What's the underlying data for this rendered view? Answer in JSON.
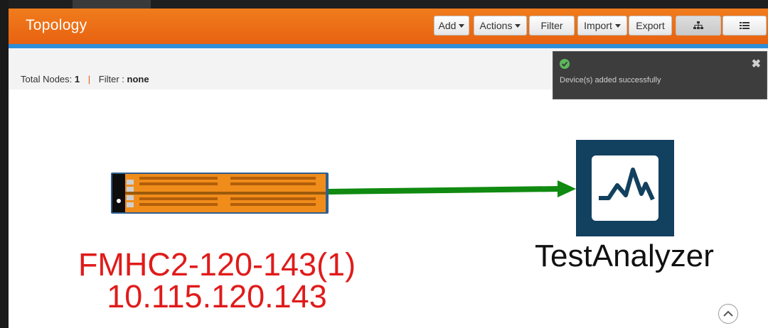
{
  "header": {
    "title": "Topology",
    "buttons": {
      "add": "Add",
      "actions": "Actions",
      "filter": "Filter",
      "import": "Import",
      "export": "Export"
    }
  },
  "info": {
    "total_nodes_label": "Total Nodes:",
    "total_nodes_value": "1",
    "separator": "|",
    "filter_label": "Filter :",
    "filter_value": "none"
  },
  "toast": {
    "message": "Device(s) added successfully",
    "close_icon": "close-icon",
    "status_icon": "check-circle-icon"
  },
  "nodes": {
    "device": {
      "name": "FMHC2-120-143(1)",
      "ip": "10.115.120.143"
    },
    "analyzer": {
      "name": "TestAnalyzer"
    }
  },
  "colors": {
    "header": "#e86210",
    "accent_line": "#2d8ed8",
    "link": "#108a10",
    "device_label": "#e01b1b",
    "analyzer_tile": "#12405f",
    "toast_bg": "#3d3d3d"
  },
  "icons": {
    "topology_view": "hierarchy-icon",
    "list_view": "list-icon",
    "scroll_up": "chevron-up-icon"
  }
}
